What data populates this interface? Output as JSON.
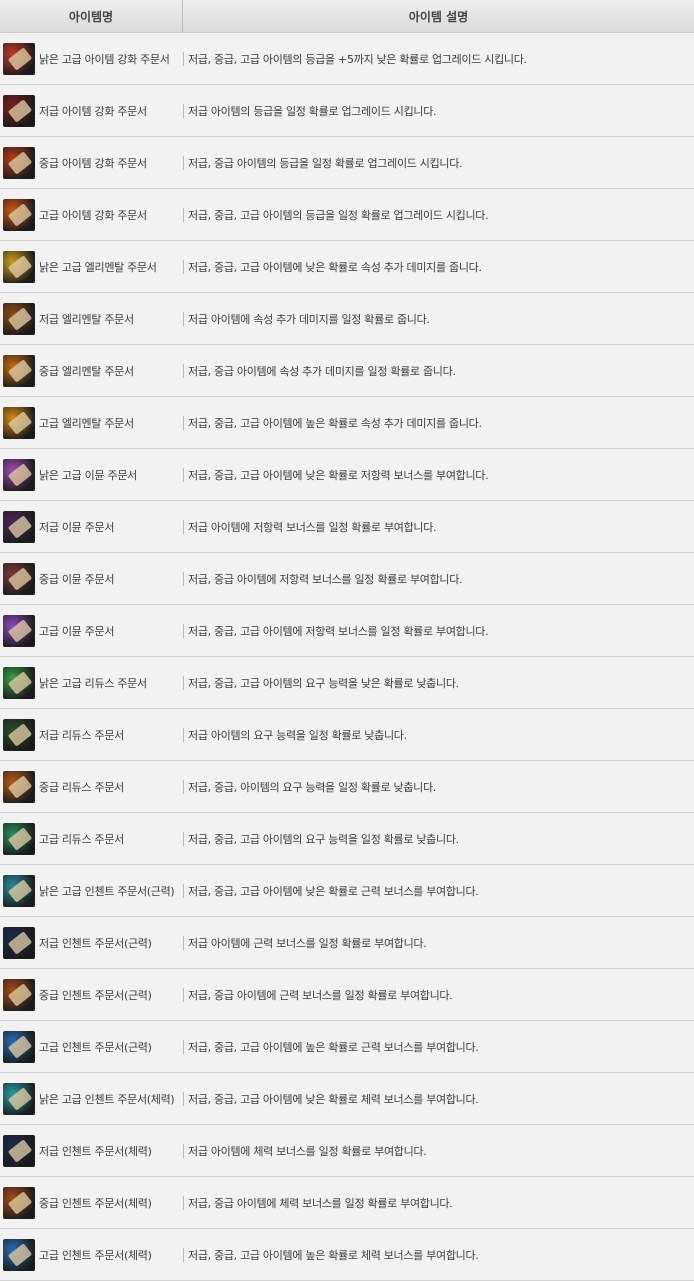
{
  "header": {
    "col_name": "아이템명",
    "col_desc": "아이템 설명"
  },
  "items": [
    {
      "name": "낡은 고급 아이템 강화 주문서",
      "desc": "저급, 중급, 고급 아이템의 등급을 +5까지 낮은 확률로 업그레이드 시킵니다.",
      "icon": "enhance-scroll-icon",
      "color": "#c0392b"
    },
    {
      "name": "저급 아이템 강화 주문서",
      "desc": "저급 아이템의 등급을 일정 확률로 업그레이드 시킵니다.",
      "icon": "enhance-scroll-icon",
      "color": "#7a1f1f"
    },
    {
      "name": "중급 아이템 강화 주문서",
      "desc": "저급, 중급 아이템의 등급을 일정 확률로 업그레이드 시킵니다.",
      "icon": "enhance-scroll-icon",
      "color": "#b23a1a"
    },
    {
      "name": "고급 아이템 강화 주문서",
      "desc": "저급, 중급, 고급 아이템의 등급을 일정 확률로 업그레이드 시킵니다.",
      "icon": "enhance-scroll-icon",
      "color": "#c9561a"
    },
    {
      "name": "낡은 고급 엘리멘탈 주문서",
      "desc": "저급, 중급, 고급 아이템에 낮은 확률로 속성 추가 데미지를 줍니다.",
      "icon": "elemental-scroll-icon",
      "color": "#c8a21c"
    },
    {
      "name": "저급 엘리멘탈 주문서",
      "desc": "저급 아이템에 속성 추가 데미지를 일정 확률로 줍니다.",
      "icon": "elemental-scroll-icon",
      "color": "#8a4a1a"
    },
    {
      "name": "중급 엘리멘탈 주문서",
      "desc": "저급, 중급 아이템에 속성 추가 데미지를 일정 확률로 줍니다.",
      "icon": "elemental-scroll-icon",
      "color": "#c06a12"
    },
    {
      "name": "고급 엘리멘탈 주문서",
      "desc": "저급, 중급, 고급 아이템에 높은 확률로 속성 추가 데미지를 줍니다.",
      "icon": "elemental-scroll-icon",
      "color": "#d08a14"
    },
    {
      "name": "낡은 고급 이뮨 주문서",
      "desc": "저급, 중급, 고급 아이템에 낮은 확률로 저항력 보너스를 부여합니다.",
      "icon": "immune-scroll-icon",
      "color": "#9a4ab0"
    },
    {
      "name": "저급 이뮨 주문서",
      "desc": "저급 아이템에 저항력 보너스를 일정 확률로 부여합니다.",
      "icon": "immune-scroll-icon",
      "color": "#4a2a5a"
    },
    {
      "name": "중급 이뮨 주문서",
      "desc": "저급, 중급 아이템에 저항력 보너스를 일정 확률로 부여합니다.",
      "icon": "immune-scroll-icon",
      "color": "#7a3a3a"
    },
    {
      "name": "고급 이뮨 주문서",
      "desc": "저급, 중급, 고급 아이템에 저항력 보너스를 일정 확률로 부여합니다.",
      "icon": "immune-scroll-icon",
      "color": "#8a4ab8"
    },
    {
      "name": "낡은 고급 리듀스 주문서",
      "desc": "저급, 중급, 고급 아이템의 요구 능력을 낮은 확률로 낮춥니다.",
      "icon": "reduce-scroll-icon",
      "color": "#3a9a4a"
    },
    {
      "name": "저급 리듀스 주문서",
      "desc": "저급 아이템의 요구 능력을 일정 확률로 낮춥니다.",
      "icon": "reduce-scroll-icon",
      "color": "#2a4a2a"
    },
    {
      "name": "중급 리듀스 주문서",
      "desc": "저급, 중급, 아이템의 요구 능력을 일정 확률로 낮춥니다.",
      "icon": "reduce-scroll-icon",
      "color": "#b25a1a"
    },
    {
      "name": "고급 리듀스 주문서",
      "desc": "저급, 중급, 고급 아이템의 요구 능력을 일정 확률로 낮춥니다.",
      "icon": "reduce-scroll-icon",
      "color": "#2a8a5a"
    },
    {
      "name": "낡은 고급 인첸트 주문서(근력)",
      "desc": "저급, 중급, 고급 아이템에 낮은 확률로 근력 보너스를 부여합니다.",
      "icon": "enchant-str-scroll-icon",
      "color": "#2a8a9a"
    },
    {
      "name": "저급 인첸트 주문서(근력)",
      "desc": "저급 아이템에 근력 보너스를 일정 확률로 부여합니다.",
      "icon": "enchant-str-scroll-icon",
      "color": "#1a2a4a"
    },
    {
      "name": "중급 인첸트 주문서(근력)",
      "desc": "저급, 중급 아이템에 근력 보너스를 일정 확률로 부여합니다.",
      "icon": "enchant-str-scroll-icon",
      "color": "#a24a1a"
    },
    {
      "name": "고급 인첸트 주문서(근력)",
      "desc": "저급, 중급, 고급 아이템에 높은 확률로 근력 보너스를 부여합니다.",
      "icon": "enchant-str-scroll-icon",
      "color": "#2a6ab0"
    },
    {
      "name": "낡은 고급 인첸트 주문서(체력)",
      "desc": "저급, 중급, 고급 아이템에 낮은 확률로 체력 보너스를 부여합니다.",
      "icon": "enchant-vit-scroll-icon",
      "color": "#2a9aa0"
    },
    {
      "name": "저급 인첸트 주문서(체력)",
      "desc": "저급 아이템에 체력 보너스를 일정 확률로 부여합니다.",
      "icon": "enchant-vit-scroll-icon",
      "color": "#1a2a4a"
    },
    {
      "name": "중급 인첸트 주문서(체력)",
      "desc": "저급, 중급 아이템에 체력 보너스를 일정 확률로 부여합니다.",
      "icon": "enchant-vit-scroll-icon",
      "color": "#a24a1a"
    },
    {
      "name": "고급 인첸트 주문서(체력)",
      "desc": "저급, 중급, 고급 아이템에 높은 확률로 체력 보너스를 부여합니다.",
      "icon": "enchant-vit-scroll-icon",
      "color": "#2a6ab0"
    }
  ]
}
